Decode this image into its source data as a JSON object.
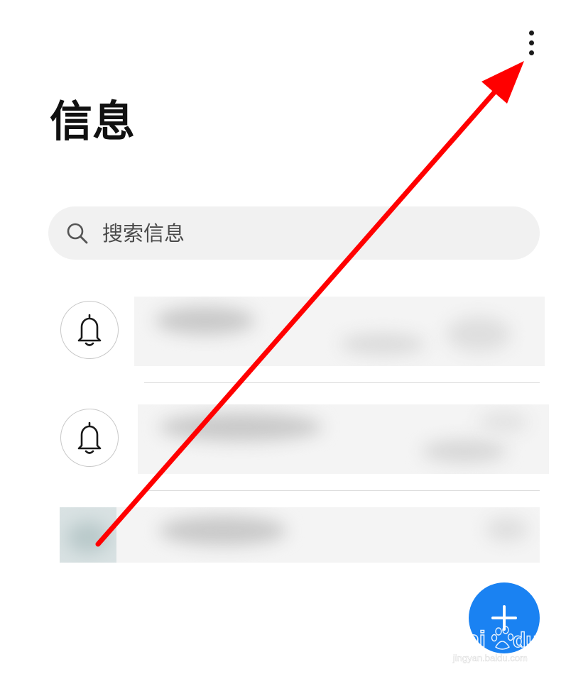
{
  "header": {
    "title": "信息",
    "more_icon": "more-vertical-icon"
  },
  "search": {
    "placeholder": "搜索信息",
    "icon": "search-icon"
  },
  "conversations": [
    {
      "avatar_icon": "bell-icon",
      "content": "blurred"
    },
    {
      "avatar_icon": "bell-icon",
      "content": "blurred"
    },
    {
      "avatar_icon": "blurred-avatar",
      "content": "blurred"
    }
  ],
  "fab": {
    "icon": "plus-icon"
  },
  "watermark": {
    "brand": "Baidu经验",
    "url": "jingyan.baidu.com"
  },
  "annotation": {
    "color": "#ff0000",
    "icon": "red-arrow"
  },
  "colors": {
    "accent": "#1a82f2",
    "title": "#111111",
    "search_bg": "#f1f1f1"
  }
}
